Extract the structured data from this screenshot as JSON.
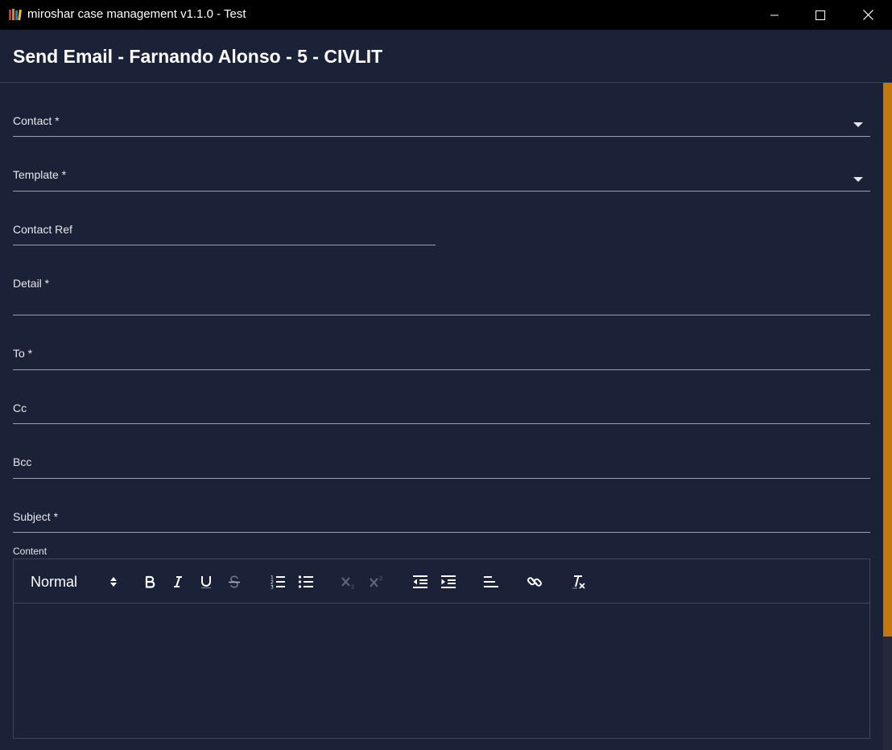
{
  "window": {
    "title": "miroshar case management v1.1.0 - Test",
    "icon": "books-icon"
  },
  "header": {
    "title": "Send Email - Farnando Alonso - 5 - CIVLIT"
  },
  "form": {
    "contact": {
      "label": "Contact *",
      "value": ""
    },
    "template": {
      "label": "Template *",
      "value": ""
    },
    "contact_ref": {
      "label": "Contact Ref",
      "value": ""
    },
    "detail": {
      "label": "Detail *",
      "value": ""
    },
    "to": {
      "label": "To *",
      "value": ""
    },
    "cc": {
      "label": "Cc",
      "value": ""
    },
    "bcc": {
      "label": "Bcc",
      "value": ""
    },
    "subject": {
      "label": "Subject *",
      "value": ""
    },
    "content": {
      "label": "Content",
      "format_value": "Normal",
      "body": ""
    }
  },
  "toolbar": {
    "buttons": [
      "bold",
      "italic",
      "underline",
      "strikethrough",
      "ordered-list",
      "bullet-list",
      "subscript",
      "superscript",
      "outdent",
      "indent",
      "align-left",
      "link",
      "clear-format"
    ]
  },
  "colors": {
    "background": "#1b2136",
    "titlebar": "#000000",
    "scroll_thumb": "#c17812",
    "text": "#e6e8ee"
  }
}
